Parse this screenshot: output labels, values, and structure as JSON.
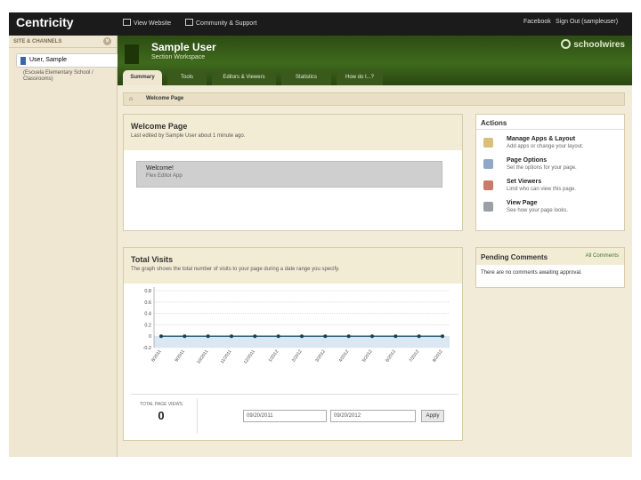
{
  "topbar": {
    "brand": "Centricity",
    "view_website": "View Website",
    "community": "Community & Support",
    "facebook": "Facebook",
    "sign_out": "Sign Out (sampleuser)"
  },
  "sidebar": {
    "heading": "SITE & CHANNELS",
    "close_symbol": "×",
    "user_item": "User, Sample",
    "user_sub": "(Escuela Elementary School / Classrooms)"
  },
  "header": {
    "title": "Sample User",
    "subtitle": "Section Workspace",
    "logo_text": "schoolwires"
  },
  "tabs": [
    {
      "label": "Summary",
      "active": true
    },
    {
      "label": "Tools",
      "active": false
    },
    {
      "label": "Editors & Viewers",
      "active": false
    },
    {
      "label": "Statistics",
      "active": false
    },
    {
      "label": "How do I...?",
      "active": false
    }
  ],
  "breadcrumb": {
    "home_icon": "home-icon",
    "current": "Welcome Page"
  },
  "welcome": {
    "title": "Welcome Page",
    "subtitle": "Last edited by Sample User about 1 minute ago.",
    "box_title": "Welcome!",
    "box_sub": "Flex Editor App"
  },
  "actions": {
    "title": "Actions",
    "items": [
      {
        "title": "Manage Apps & Layout",
        "desc": "Add apps or change your layout.",
        "icon": "layout-icon",
        "color": "#d8c07a"
      },
      {
        "title": "Page Options",
        "desc": "Set the options for your page.",
        "icon": "options-icon",
        "color": "#8fa7c9"
      },
      {
        "title": "Set Viewers",
        "desc": "Limit who can view this page.",
        "icon": "viewers-icon",
        "color": "#c97a6a"
      },
      {
        "title": "View Page",
        "desc": "See how your page looks.",
        "icon": "magnifier-icon",
        "color": "#9aa0a6"
      }
    ]
  },
  "visits": {
    "title": "Total Visits",
    "subtitle": "The graph shows the total number of visits to your page during a date range you specify.",
    "tpv_label": "TOTAL PAGE VIEWS",
    "tpv_value": "0",
    "start_date": "09/20/2011",
    "end_date": "09/20/2012",
    "apply_label": "Apply"
  },
  "pending": {
    "title": "Pending Comments",
    "link": "All Comments",
    "body": "There are no comments awaiting approval."
  },
  "chart_data": {
    "type": "line",
    "x": [
      "8/2011",
      "9/2011",
      "10/2011",
      "11/2011",
      "12/2011",
      "1/2012",
      "2/2012",
      "3/2012",
      "4/2012",
      "5/2012",
      "6/2012",
      "7/2012",
      "8/2012"
    ],
    "series": [
      {
        "values": [
          0,
          0,
          0,
          0,
          0,
          0,
          0,
          0,
          0,
          0,
          0,
          0,
          0
        ]
      }
    ],
    "yticks": [
      "0.8",
      "0.6",
      "0.4",
      "0.2",
      "0",
      "-0.2"
    ],
    "ylim": [
      -0.2,
      0.8
    ],
    "grid": true,
    "colors": {
      "line": "#2b5f7a",
      "marker": "#1f3f52",
      "fill": "#dbe8f4",
      "grid": "#c8c8c8"
    }
  }
}
